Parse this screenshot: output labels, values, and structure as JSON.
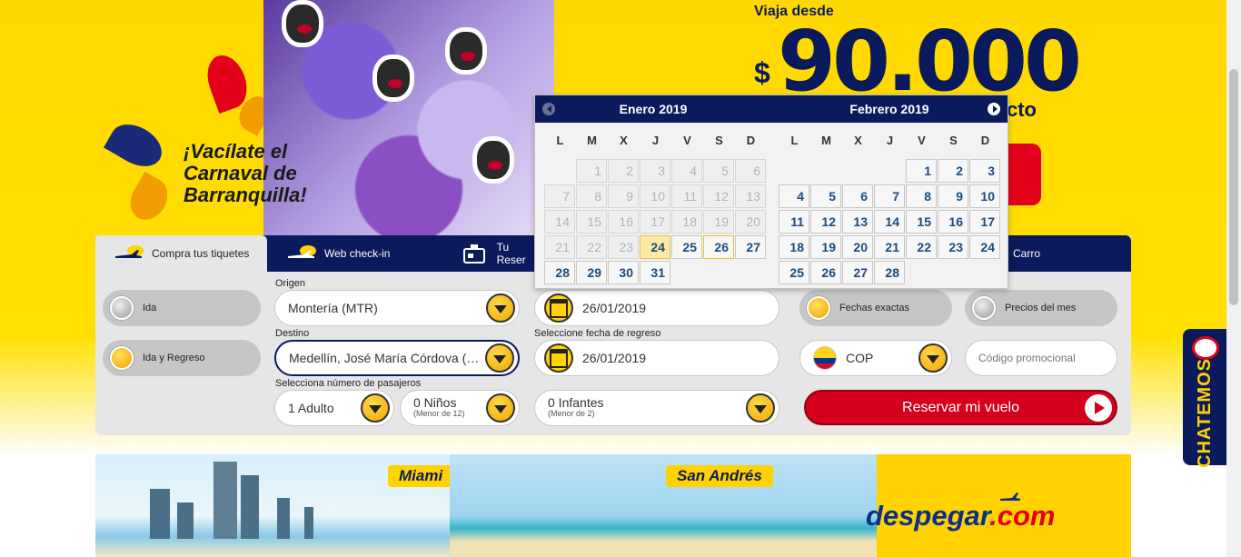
{
  "hero": {
    "carnival_line1": "¡Vacílate el",
    "carnival_line2": "Carnaval de",
    "carnival_line3": "Barranquilla!",
    "promo_top": "Viaja desde",
    "promo_currency": "$",
    "promo_amount": "90.000",
    "promo_star": "*",
    "promo_suffix": "cto"
  },
  "tabs": [
    {
      "label": "Compra tus tiquetes",
      "icon": "plane-icon"
    },
    {
      "label": "Web check-in",
      "icon": "plane-checkin-icon"
    },
    {
      "label": "Tu Reser",
      "icon": "reservation-icon"
    },
    {
      "label": "Carro",
      "icon": ""
    }
  ],
  "trip_type": {
    "one_way": "Ida",
    "round_trip": "Ida y Regreso",
    "selected": "Ida y Regreso"
  },
  "origin": {
    "label": "Origen",
    "value": "Montería (MTR)"
  },
  "destination": {
    "label": "Destino",
    "value": "Medellín, José María Córdova (MDE)"
  },
  "departure": {
    "value": "26/01/2019"
  },
  "return": {
    "label": "Seleccione fecha de regreso",
    "value": "26/01/2019"
  },
  "passengers": {
    "label": "Selecciona número de pasajeros",
    "adults": "1 Adulto",
    "children": "0 Niños",
    "children_note": "(Menor de 12)",
    "infants": "0 Infantes",
    "infants_note": "(Menor de 2)"
  },
  "date_options": {
    "exact": "Fechas exactas",
    "monthly": "Precios del mes"
  },
  "currency": {
    "value": "COP"
  },
  "promo_code": {
    "placeholder": "Código promocional"
  },
  "reserve_button": "Reservar mi vuelo",
  "calendar": {
    "weekdays": [
      "L",
      "M",
      "X",
      "J",
      "V",
      "S",
      "D"
    ],
    "months": [
      {
        "title": "Enero 2019",
        "offset": 1,
        "days": 31,
        "disabled_until": 23,
        "selected": 24,
        "today": 26
      },
      {
        "title": "Febrero 2019",
        "offset": 4,
        "days": 28,
        "disabled_until": 0,
        "selected": 0,
        "today": 0
      }
    ]
  },
  "banner": {
    "tag_miami": "Miami",
    "tag_san_andres": "San Andrés",
    "brand_part1": "despegar",
    "brand_part2": ".com"
  },
  "chat": {
    "label": "CHATEMOS"
  },
  "colors": {
    "brand_navy": "#0a1a5c",
    "brand_yellow": "#ffd800",
    "brand_red": "#d4001c"
  }
}
